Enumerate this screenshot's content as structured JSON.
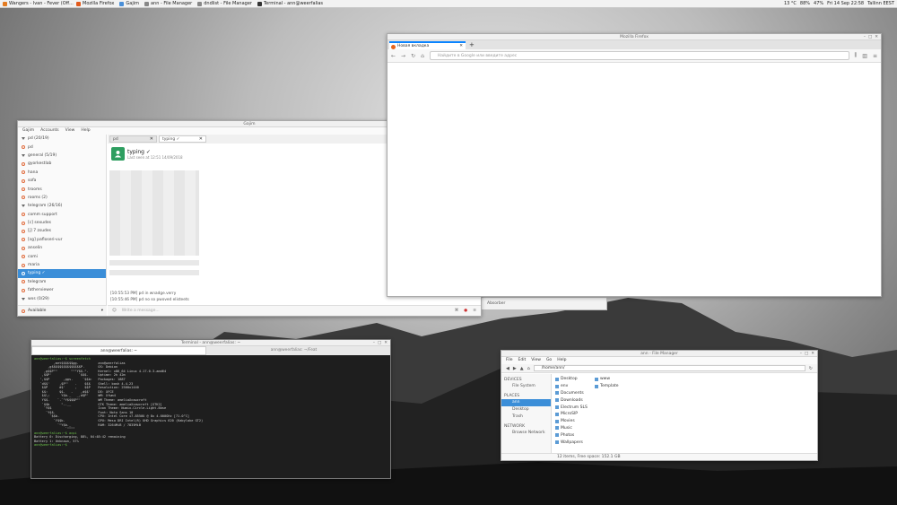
{
  "panel": {
    "tasks": [
      {
        "label": "Wangers - Ivan - Fever (Off...",
        "color": "#e47b20"
      },
      {
        "label": "Mozilla Firefox",
        "color": "#e25a1c"
      },
      {
        "label": "Gajim",
        "color": "#4a8fd8"
      },
      {
        "label": "ann - File Manager",
        "color": "#888888"
      },
      {
        "label": "dndlist - File Manager",
        "color": "#888888"
      },
      {
        "label": "Terminal - ann@weerfalias",
        "color": "#333333"
      }
    ],
    "tray": {
      "temp": "13 °C",
      "battery": "88%",
      "volume": "47%",
      "clock": "Fri 14 Sep 22:58",
      "tz": "Tallinn EEST"
    }
  },
  "gajim": {
    "title": "Gajim",
    "menu": [
      "Gajim",
      "Accounts",
      "View",
      "Help"
    ],
    "roster": [
      {
        "label": "pd (20/19)",
        "group": true
      },
      {
        "label": "pd",
        "group": false
      },
      {
        "label": "general (5/19)",
        "group": true
      },
      {
        "label": "gyorkestlab",
        "group": false
      },
      {
        "label": "hana",
        "group": false
      },
      {
        "label": "sofa",
        "group": false
      },
      {
        "label": "trooms",
        "group": false
      },
      {
        "label": "rooms (2)",
        "group": false
      },
      {
        "label": "telegram (26/16)",
        "group": true
      },
      {
        "label": "comm support",
        "group": false
      },
      {
        "label": "[c] sexudes",
        "group": false
      },
      {
        "label": "[j] 7 zsudes",
        "group": false
      },
      {
        "label": "[sg] pafloseri-vur",
        "group": false
      },
      {
        "label": "anselin",
        "group": false
      },
      {
        "label": "comi",
        "group": false
      },
      {
        "label": "maria",
        "group": false
      },
      {
        "label": "typing ✓",
        "group": false,
        "selected": true
      },
      {
        "label": "telegram",
        "group": false
      },
      {
        "label": "fatherviewer",
        "group": false
      },
      {
        "label": "wxs (0/29)",
        "group": true
      }
    ],
    "status": "Available",
    "tabs": [
      {
        "label": "pd",
        "active": false
      },
      {
        "label": "typing ✓",
        "active": true
      }
    ],
    "contact": {
      "name": "typing ✓",
      "last_seen": "Last seen at 12:51 14/09/2018"
    },
    "messages": [
      "[10:55:53 PM] pd in wnadge.verry",
      "[10:55:46 PM] pd no so pwoved elisteets"
    ],
    "input_placeholder": "Write a message..."
  },
  "firefox": {
    "title": "Mozilla Firefox",
    "tab_label": "Новая вкладка",
    "url_placeholder": "Найдите в Google или введите адрес"
  },
  "middle_strip": {
    "label": "Absorber"
  },
  "terminal": {
    "title": "Terminal - ann@weerfalias: ~",
    "tabs": [
      "ann@weerfalias: ~",
      "ann@weerfalias: ~/Feat"
    ],
    "lines": [
      "ann@weerfalias:~$ screenfetch",
      "          ,met$$$$$$gg.          ann@weerfalias",
      "       ,g$$$$$$$$$$$$$$$P.       OS: Debian",
      "     ,g$$P\"\"       \"\"\"Y$$.\".     Kernel: x86_64 Linux 4.17.0-3-amd64",
      "    ,$$P'              `$$$.     Uptime: 2h 42m",
      "   ',$$P       ,ggs.     `$$b:   Packages: 1887",
      "   `d$$'     ,$P\"'   .    $$$    Shell: bash 4.4.23",
      "    $$P      d$'     ,    $$P    Resolution: 2560x1440",
      "    $$:      $$.   -    ,d$$'    DE: XFCE",
      "    $$\\;      Y$b._   _,d$P'     WM: Xfwm4",
      "    Y$$.    `.`\"Y$$$$P\"'         WM Theme: ameliaXcowcraft",
      "    `$$b      \"-.__              GTK Theme: ameliaXcowcraft [GTK2]",
      "     `Y$$                        Icon Theme: Numix-Circle-Light-Base",
      "      `Y$$.                      Font: Noto Sans 10",
      "        `$$b.                    CPU: Intel Core i7-8550U @ 8x 4.000GHz [71.0°C]",
      "          `Y$$b.                 GPU: Mesa DRI Intel(R) UHD Graphics 620 (Kabylake GT2)",
      "            `\"Y$b._              RAM: 3264MiB / 7835MiB",
      "                `\"\"\"\"",
      "",
      "ann@weerfalias:~$ acpi",
      "Battery 0: Discharging, 88%, 04:48:42 remaining",
      "Battery 1: Unknown, 57%",
      "ann@weerfalias:~$ "
    ]
  },
  "filemanager": {
    "title": "ann - File Manager",
    "menu": [
      "File",
      "Edit",
      "View",
      "Go",
      "Help"
    ],
    "path": "/home/ann/",
    "sidebar": {
      "devices_header": "DEVICES",
      "devices": [
        "File System"
      ],
      "places_header": "PLACES",
      "places": [
        "ann",
        "Desktop",
        "Trash"
      ],
      "network_header": "NETWORK",
      "network": [
        "Browse Network"
      ]
    },
    "files_col1": [
      "Desktop",
      "env",
      "Documents",
      "Downloads",
      "Electrum SLS",
      "MicroSIP",
      "Movies",
      "Music",
      "Photos",
      "Wallpapers"
    ],
    "files_col2": [
      "www",
      "Template"
    ],
    "status": "12 items, Free space: 152.1 GB"
  }
}
